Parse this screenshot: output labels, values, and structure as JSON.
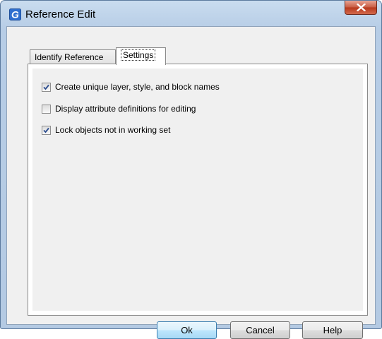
{
  "window": {
    "title": "Reference Edit",
    "app_icon_letter": "G"
  },
  "tabs": [
    {
      "label": "Identify Reference",
      "active": false
    },
    {
      "label": "Settings",
      "active": true
    }
  ],
  "options": [
    {
      "label": "Create unique layer, style, and block names",
      "checked": true
    },
    {
      "label": "Display attribute definitions for editing",
      "checked": false
    },
    {
      "label": "Lock objects not in working set",
      "checked": true
    }
  ],
  "buttons": {
    "ok": "Ok",
    "cancel": "Cancel",
    "help": "Help"
  },
  "colors": {
    "check_mark": "#2a4b8d",
    "icon_blue": "#2f6fcf"
  }
}
